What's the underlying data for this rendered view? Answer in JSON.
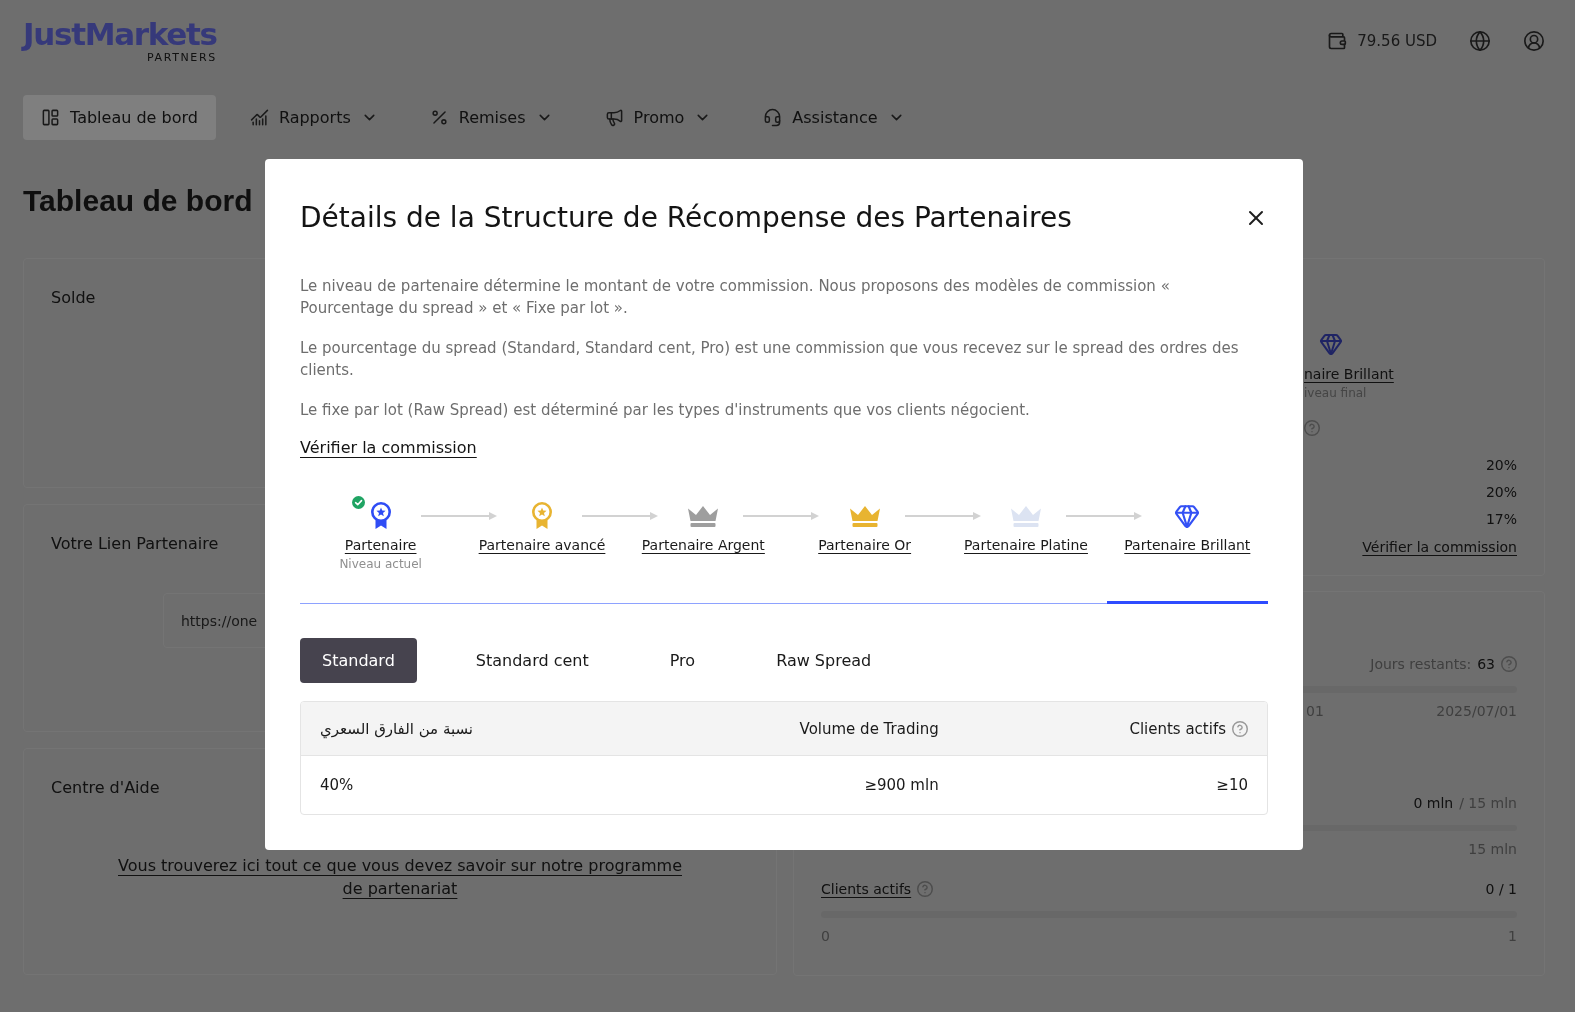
{
  "header": {
    "logo": {
      "name": "JustMarkets",
      "tagline": "PARTNERS"
    },
    "balance": "79.56 USD"
  },
  "nav": [
    {
      "label": "Tableau de bord",
      "selected": true,
      "dropdown": false
    },
    {
      "label": "Rapports",
      "selected": false,
      "dropdown": true
    },
    {
      "label": "Remises",
      "selected": false,
      "dropdown": true
    },
    {
      "label": "Promo",
      "selected": false,
      "dropdown": true
    },
    {
      "label": "Assistance",
      "selected": false,
      "dropdown": true
    }
  ],
  "page_title": "Tableau de bord",
  "balance_card": {
    "title": "Solde"
  },
  "link_card": {
    "title": "Votre Lien Partenaire",
    "value": "https://one"
  },
  "help_card": {
    "title": "Centre d'Aide",
    "link": "Vous trouverez ici tout ce que vous devez savoir sur notre programme de partenariat"
  },
  "level_card": {
    "level_name": "naire Brillant",
    "level_note": "iveau final",
    "rates": [
      "20%",
      "20%",
      "17%"
    ],
    "link": "Vérifier la commission"
  },
  "progress_card": {
    "days_label": "Jours restants:",
    "days_value": "63",
    "period_start": "01",
    "period_end": "2025/07/01",
    "volume_value": "0 mln",
    "volume_target": "/ 15 mln",
    "volume_max": "15 mln",
    "clients_label": "Clients actifs",
    "clients_value": "0 / 1",
    "clients_min": "0",
    "clients_max": "1"
  },
  "modal": {
    "title": "Détails de la Structure de Récompense des Partenaires",
    "paragraphs": [
      "Le niveau de partenaire détermine le montant de votre commission. Nous proposons des modèles de commission « Pourcentage du spread » et « Fixe par lot ».",
      "Le pourcentage du spread (Standard, Standard cent, Pro) est une commission que vous recevez sur le spread des ordres des clients.",
      "Le fixe par lot (Raw Spread) est déterminé par les types d'instruments que vos clients négocient."
    ],
    "link": "Vérifier la commission",
    "levels": [
      {
        "label": "Partenaire",
        "kind": "medal",
        "color": "#2f4cf5",
        "current": true,
        "note": "Niveau actuel",
        "selected": false
      },
      {
        "label": "Partenaire avancé",
        "kind": "medal",
        "color": "#e8b431",
        "current": false,
        "selected": false
      },
      {
        "label": "Partenaire Argent",
        "kind": "crown",
        "color": "#9e9e9e",
        "current": false,
        "selected": false
      },
      {
        "label": "Partenaire Or",
        "kind": "crown",
        "color": "#e8b431",
        "current": false,
        "selected": false
      },
      {
        "label": "Partenaire Platine",
        "kind": "crown",
        "color": "#dce3f2",
        "current": false,
        "selected": false
      },
      {
        "label": "Partenaire Brillant",
        "kind": "diamond",
        "color": "#3350f5",
        "current": false,
        "selected": true
      }
    ],
    "account_tabs": [
      {
        "label": "Standard",
        "selected": true
      },
      {
        "label": "Standard cent",
        "selected": false
      },
      {
        "label": "Pro",
        "selected": false
      },
      {
        "label": "Raw Spread",
        "selected": false
      }
    ],
    "table": {
      "columns": [
        {
          "label": "نسبة من الفارق السعري",
          "help": false
        },
        {
          "label": "Volume de Trading",
          "help": false
        },
        {
          "label": "Clients actifs",
          "help": true
        }
      ],
      "rows": [
        [
          "40%",
          "≥900 mln",
          "≥10"
        ]
      ]
    }
  }
}
